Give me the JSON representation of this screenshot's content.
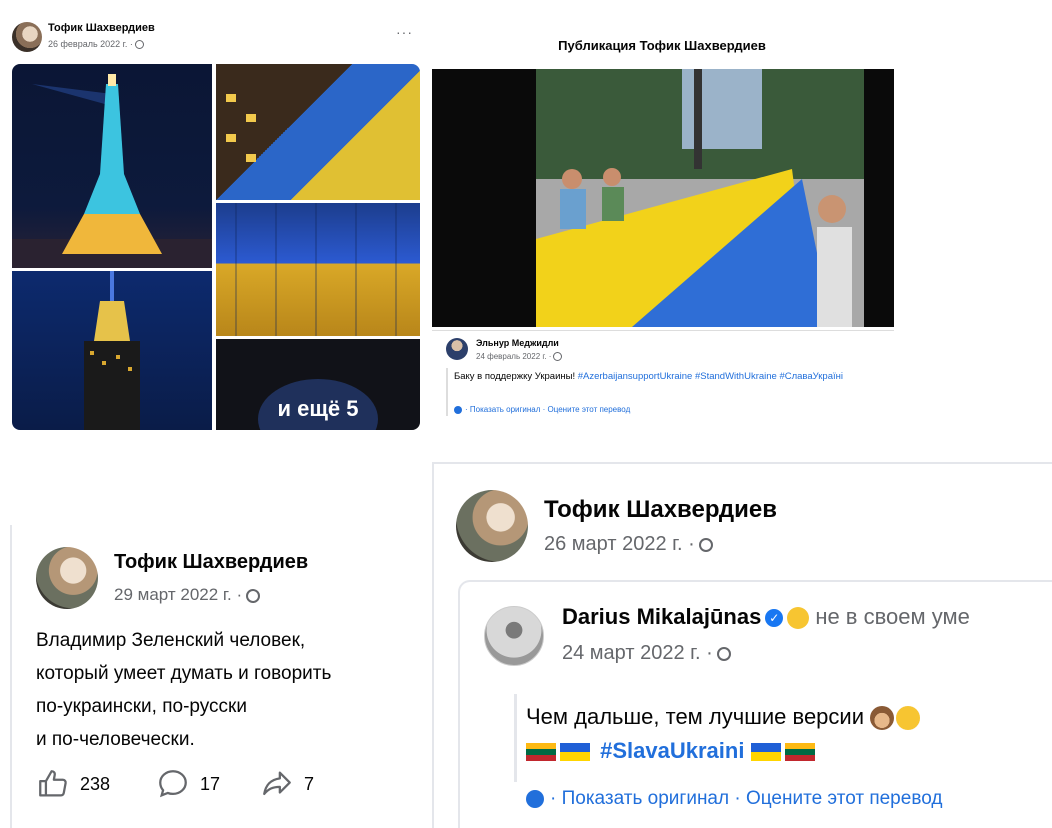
{
  "panel1": {
    "author": "Тофик Шахвердиев",
    "date": "26 февраль 2022 г. ·",
    "more_menu": "···",
    "more_photos": "и ещё 5"
  },
  "panel2": {
    "header": "Публикация Тофик Шахвердиев",
    "author": "Эльнур Меджидли",
    "date": "24 февраль 2022 г. ·",
    "text_prefix": "Баку в поддержку Украины! ",
    "hashtags": "#AzerbaijansupportUkraine #StandWithUkraine #СлаваУкраїні",
    "translate_links": "· Показать оригинал · Оцените этот перевод"
  },
  "panel3": {
    "author": "Тофик Шахвердиев",
    "date": "29 март 2022 г. ·",
    "text_lines": [
      "Владимир Зеленский человек,",
      "который умеет думать и говорить",
      "по-украински, по-русски",
      "и по-человечески."
    ],
    "likes": "238",
    "comments": "17",
    "shares": "7"
  },
  "panel4": {
    "author": "Тофик Шахвердиев",
    "date": "26 март 2022 г. ·",
    "shared": {
      "author": "Darius Mikalajūnas",
      "context": "не в своем уме",
      "date": "24 март 2022 г. ·",
      "text_line1": "Чем дальше, тем лучшие версии",
      "hashtag": "#SlavaUkraini",
      "translate_links": "· Показать оригинал · Оцените этот перевод"
    }
  }
}
